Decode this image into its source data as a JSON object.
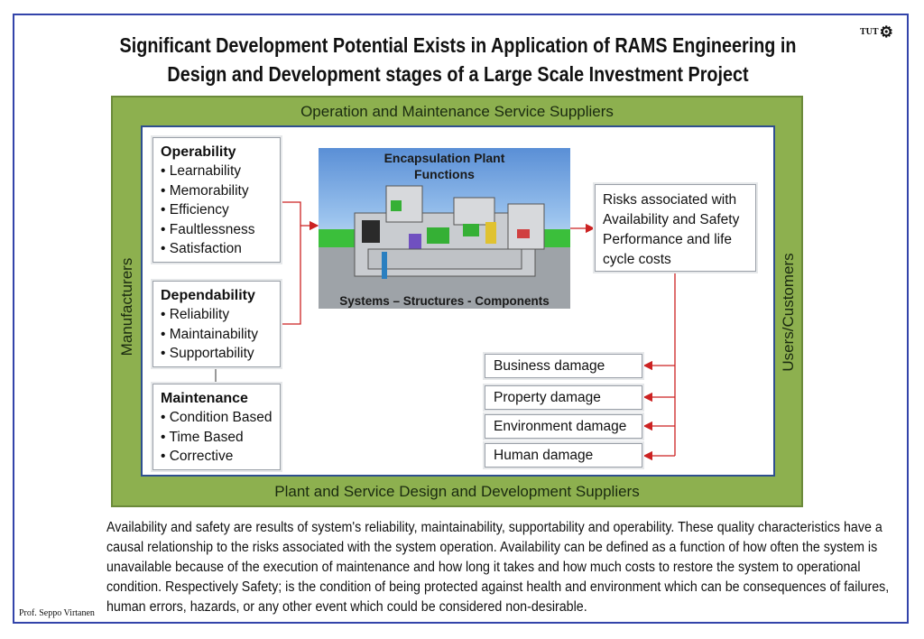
{
  "title_line1": "Significant Development Potential Exists in Application of RAMS Engineering in",
  "title_line2": "Design and Development stages of a Large Scale Investment Project",
  "logo_text": "TUT",
  "bands": {
    "top": "Operation and Maintenance Service Suppliers",
    "bottom": "Plant and Service Design and Development Suppliers",
    "left": "Manufacturers",
    "right": "Users/Customers"
  },
  "categories": [
    {
      "heading": "Operability",
      "items": [
        "Learnability",
        "Memorability",
        "Efficiency",
        "Faultlessness",
        "Satisfaction"
      ]
    },
    {
      "heading": "Dependability",
      "items": [
        "Reliability",
        "Maintainability",
        "Supportability"
      ]
    },
    {
      "heading": "Maintenance",
      "items": [
        "Condition Based",
        "Time Based",
        "Corrective"
      ]
    }
  ],
  "plant": {
    "title": "Encapsulation Plant Functions",
    "caption": "Systems – Structures - Components"
  },
  "risk_text": "Risks associated with Availability and Safety Performance and life cycle costs",
  "damages": [
    "Business damage",
    "Property damage",
    "Environment damage",
    "Human damage"
  ],
  "description": "Availability and safety are results of system's reliability, maintainability, supportability and operability. These quality characteristics have a causal relationship to the risks associated with the system operation. Availability can be defined as a function of how often the system is unavailable because of the execution of maintenance and how long it takes and how much costs to restore the system to operational condition. Respectively Safety; is the condition of being protected against health and environment which can be consequences of failures, human errors, hazards, or any other event which could be considered non-desirable.",
  "author": "Prof. Seppo Virtanen",
  "colors": {
    "frame": "#3344aa",
    "outer_band": "#8db04f",
    "arrow": "#cc2222"
  }
}
